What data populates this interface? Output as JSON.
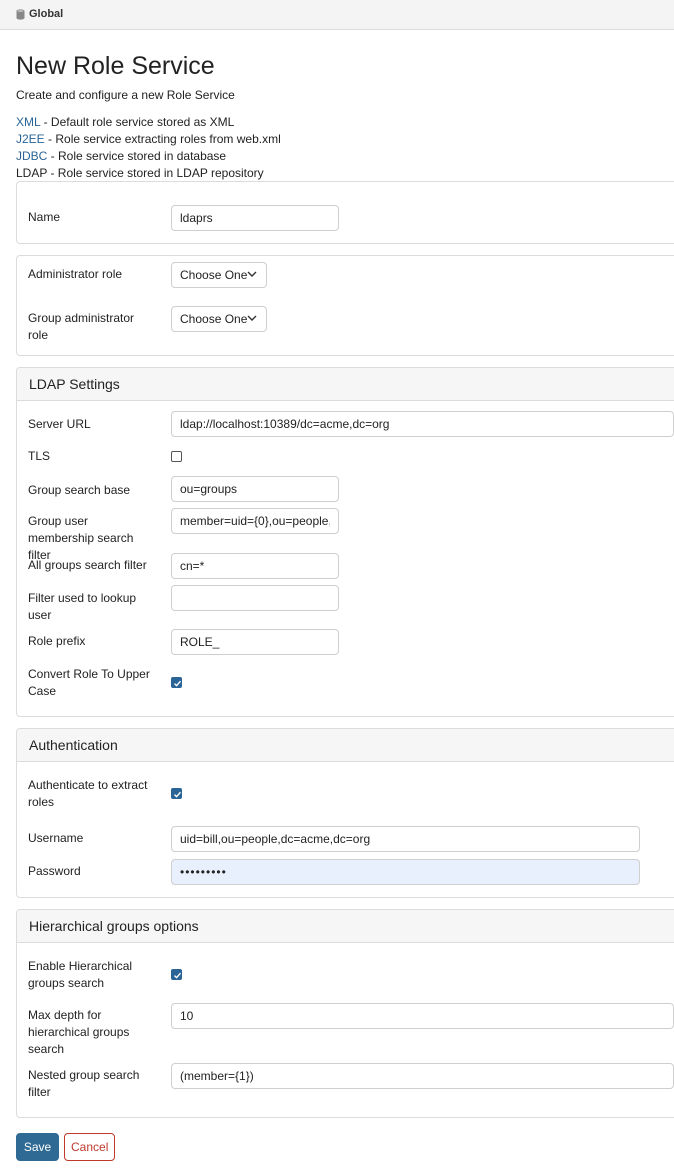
{
  "topbar": {
    "icon": "database-icon",
    "label": "Global"
  },
  "page": {
    "title": "New Role Service",
    "subtitle": "Create and configure a new Role Service"
  },
  "services": [
    {
      "link": "XML",
      "desc": " - Default role service stored as XML"
    },
    {
      "link": "J2EE",
      "desc": " - Role service extracting roles from web.xml"
    },
    {
      "link": "JDBC",
      "desc": " - Role service stored in database"
    },
    {
      "link": "",
      "desc": "LDAP - Role service stored in LDAP repository"
    }
  ],
  "name_section": {
    "label": "Name",
    "value": "ldaprs"
  },
  "roles_section": {
    "admin_role_label": "Administrator role",
    "admin_role_value": "Choose One",
    "group_admin_role_label": "Group administrator role",
    "group_admin_role_value": "Choose One"
  },
  "ldap": {
    "heading": "LDAP Settings",
    "server_url_label": "Server URL",
    "server_url_value": "ldap://localhost:10389/dc=acme,dc=org",
    "tls_label": "TLS",
    "tls_checked": false,
    "group_search_base_label": "Group search base",
    "group_search_base_value": "ou=groups",
    "membership_filter_label": "Group user membership search filter",
    "membership_filter_value": "member=uid={0},ou=people,",
    "all_groups_filter_label": "All groups search filter",
    "all_groups_filter_value": "cn=*",
    "lookup_user_filter_label": "Filter used to lookup user",
    "lookup_user_filter_value": "",
    "role_prefix_label": "Role prefix",
    "role_prefix_value": "ROLE_",
    "convert_upper_label": "Convert Role To Upper Case",
    "convert_upper_checked": true
  },
  "auth": {
    "heading": "Authentication",
    "authenticate_label": "Authenticate to extract roles",
    "authenticate_checked": true,
    "username_label": "Username",
    "username_value": "uid=bill,ou=people,dc=acme,dc=org",
    "password_label": "Password",
    "password_value": "•••••••••"
  },
  "hier": {
    "heading": "Hierarchical groups options",
    "enable_label": "Enable Hierarchical groups search",
    "enable_checked": true,
    "max_depth_label": "Max depth for hierarchical groups search",
    "max_depth_value": "10",
    "nested_filter_label": "Nested group search filter",
    "nested_filter_value": "(member={1})"
  },
  "actions": {
    "save_label": "Save",
    "cancel_label": "Cancel"
  },
  "colors": {
    "link": "#2a6496",
    "primary": "#2f6a94",
    "danger": "#c0392b",
    "autofill": "#e8f0fe"
  }
}
